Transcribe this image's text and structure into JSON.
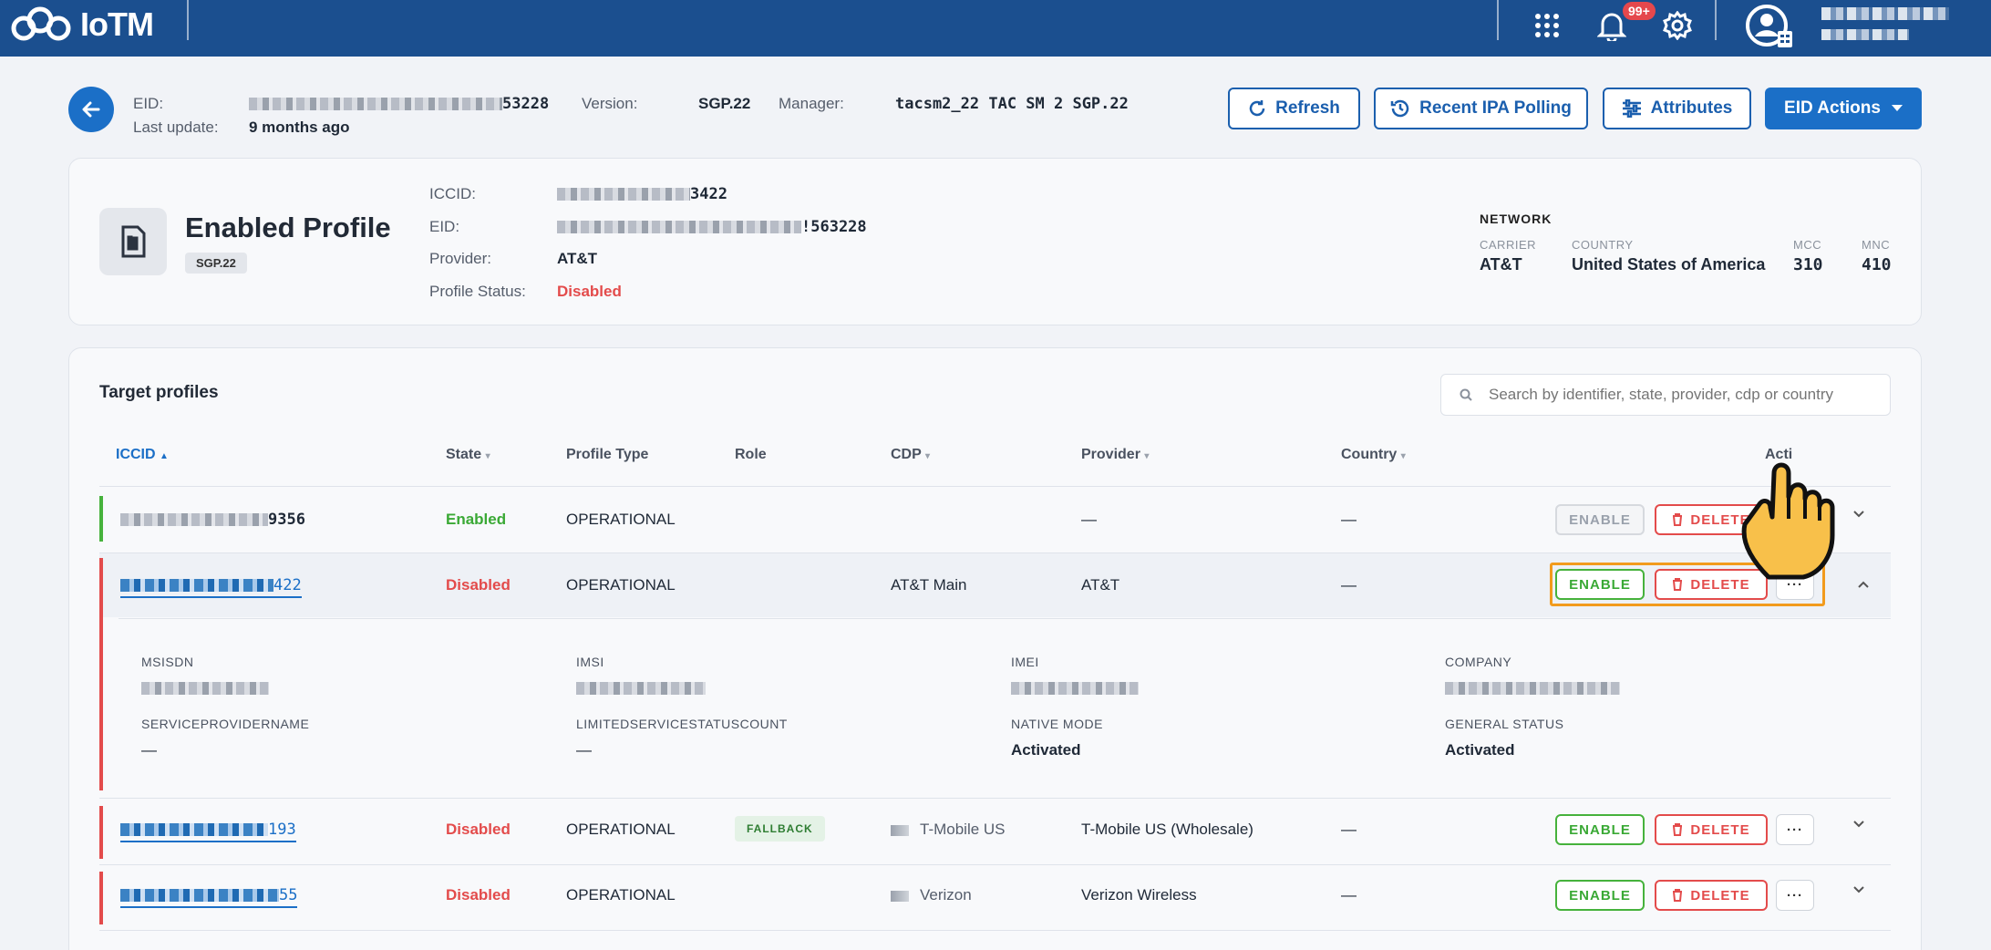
{
  "app": {
    "name": "IoTM",
    "notification_count": "99+"
  },
  "header": {
    "eid_label": "EID:",
    "eid_suffix": "53228",
    "last_update_label": "Last update:",
    "last_update_value": "9 months ago",
    "version_label": "Version:",
    "version_value": "SGP.22",
    "manager_label": "Manager:",
    "manager_value": "tacsm2_22 TAC SM 2 SGP.22",
    "buttons": {
      "refresh": "Refresh",
      "recent_ipa": "Recent IPA Polling",
      "attributes": "Attributes",
      "eid_actions": "EID Actions"
    }
  },
  "enabled_profile": {
    "title": "Enabled Profile",
    "chip": "SGP.22",
    "iccid_label": "ICCID:",
    "iccid_suffix": "3422",
    "eid_label": "EID:",
    "eid_suffix": "!563228",
    "provider_label": "Provider:",
    "provider_value": "AT&T",
    "status_label": "Profile Status:",
    "status_value": "Disabled",
    "network": {
      "heading": "NETWORK",
      "carrier_label": "CARRIER",
      "carrier_value": "AT&T",
      "country_label": "COUNTRY",
      "country_value": "United States of America",
      "mcc_label": "MCC",
      "mcc_value": "310",
      "mnc_label": "MNC",
      "mnc_value": "410"
    }
  },
  "target_profiles": {
    "title": "Target profiles",
    "search_placeholder": "Search by identifier, state, provider, cdp or country",
    "columns": {
      "iccid": "ICCID",
      "state": "State",
      "profile_type": "Profile Type",
      "role": "Role",
      "cdp": "CDP",
      "provider": "Provider",
      "country": "Country",
      "actions": "Acti"
    },
    "rows": [
      {
        "iccid_suffix": "9356",
        "state": "Enabled",
        "profile_type": "OPERATIONAL",
        "role": "",
        "cdp": "",
        "provider": "—",
        "country": "—"
      },
      {
        "iccid_suffix": "422",
        "state": "Disabled",
        "profile_type": "OPERATIONAL",
        "role": "",
        "cdp": "AT&T Main",
        "provider": "AT&T",
        "country": "—"
      },
      {
        "iccid_suffix": "193",
        "state": "Disabled",
        "profile_type": "OPERATIONAL",
        "role": "FALLBACK",
        "cdp": "T-Mobile US",
        "provider": "T-Mobile US (Wholesale)",
        "country": "—"
      },
      {
        "iccid_suffix": "55",
        "state": "Disabled",
        "profile_type": "OPERATIONAL",
        "role": "",
        "cdp": "Verizon",
        "provider": "Verizon Wireless",
        "country": "—"
      }
    ],
    "details": {
      "msisdn_label": "MSISDN",
      "imsi_label": "IMSI",
      "imei_label": "IMEI",
      "company_label": "COMPANY",
      "spn_label": "SERVICEPROVIDERNAME",
      "spn_value": "—",
      "lsc_label": "LIMITEDSERVICESTATUSCOUNT",
      "lsc_value": "—",
      "native_label": "NATIVE MODE",
      "native_value": "Activated",
      "general_label": "GENERAL STATUS",
      "general_value": "Activated"
    },
    "actions": {
      "enable": "ENABLE",
      "delete": "DELETE",
      "more": "···"
    }
  },
  "colors": {
    "topbar": "#1b4f8f",
    "primary": "#1b6fc7",
    "enabled": "#3aa935",
    "disabled": "#e34b4b",
    "highlight": "#f29b1d"
  }
}
